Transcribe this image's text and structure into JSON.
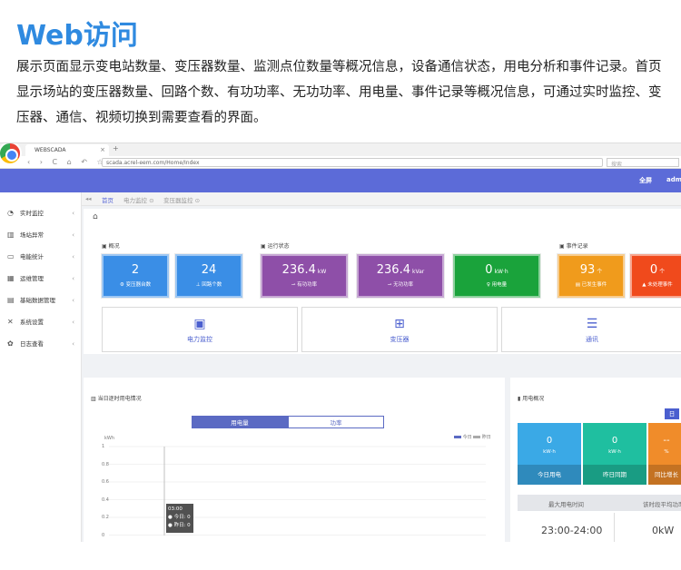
{
  "doc": {
    "title": "Web访问",
    "paragraph": "展示页面显示变电站数量、变压器数量、监测点位数量等概况信息，设备通信状态，用电分析和事件记录。首页显示场站的变压器数量、回路个数、有功功率、无功功率、用电量、事件记录等概况信息，可通过实时监控、变压器、通信、视频切换到需要查看的界面。"
  },
  "browser": {
    "tab_title": "WEBSCADA",
    "tab_close": "×",
    "new_tab": "+",
    "nav": "‹ › C ⌂ ↶ ☆",
    "url": "scada.acrel-eem.com/Home/Index",
    "search_hint": "搜索"
  },
  "header": {
    "fullscreen": "全屏",
    "user": "admin"
  },
  "sidebar": {
    "items": [
      {
        "icon": "gauge-icon",
        "glyph": "◔",
        "label": "实时监控"
      },
      {
        "icon": "building-icon",
        "glyph": "▥",
        "label": "场站异常"
      },
      {
        "icon": "monitor-icon",
        "glyph": "▭",
        "label": "电能统计"
      },
      {
        "icon": "grid-icon",
        "glyph": "▦",
        "label": "运维管理"
      },
      {
        "icon": "calendar-icon",
        "glyph": "▤",
        "label": "基础数据管理"
      },
      {
        "icon": "tools-icon",
        "glyph": "✕",
        "label": "系统设置"
      },
      {
        "icon": "gear-icon",
        "glyph": "✿",
        "label": "日志查看"
      }
    ]
  },
  "tabs": {
    "collapse": "◂◂",
    "items": [
      "首页",
      "电力监控 ⊙",
      "变压器监控 ⊙"
    ]
  },
  "overview": {
    "title": "概况",
    "cards": [
      {
        "value": "2",
        "unit": "",
        "label": "变压器台数",
        "color": "#3a8ee6"
      },
      {
        "value": "24",
        "unit": "",
        "label": "回路个数",
        "color": "#3a8ee6"
      }
    ]
  },
  "status": {
    "title": "运行状态",
    "cards": [
      {
        "value": "236.4",
        "unit": "kW",
        "label": "有功功率",
        "color": "#8e4fa8"
      },
      {
        "value": "236.4",
        "unit": "kVar",
        "label": "无功功率",
        "color": "#8e4fa8"
      },
      {
        "value": "0",
        "unit": "kW·h",
        "label": "用电量",
        "color": "#1aa33b"
      }
    ]
  },
  "events": {
    "title": "事件记录",
    "cards": [
      {
        "value": "93",
        "unit": "个",
        "label": "已发生事件",
        "color": "#f09b1c"
      },
      {
        "value": "0",
        "unit": "个",
        "label": "未处理事件",
        "color": "#f04a1c"
      }
    ]
  },
  "tiles": [
    {
      "icon": "power-monitor-icon",
      "label": "电力监控"
    },
    {
      "icon": "transformer-icon",
      "label": "变压器"
    },
    {
      "icon": "communication-icon",
      "label": "通讯"
    }
  ],
  "chart": {
    "title": "当日逐时用电情况",
    "toggle": [
      "用电量",
      "功率"
    ],
    "unit": "kWh",
    "legend": [
      "今日",
      "昨日"
    ],
    "yticks": [
      "1",
      "0.8",
      "0.6",
      "0.4",
      "0.2",
      "0"
    ],
    "tooltip": {
      "time": "03:00",
      "today": "今日: 0",
      "yesterday": "昨日: 0"
    }
  },
  "usage": {
    "title": "用电概况",
    "day_btn": "日",
    "cards": [
      {
        "value": "0",
        "unit": "kW·h",
        "label": "今日用电",
        "color": "#3aa9e6"
      },
      {
        "value": "0",
        "unit": "kW·h",
        "label": "昨日同期",
        "color": "#1fbfa0"
      },
      {
        "value": "--",
        "unit": "%",
        "label": "同比增长",
        "color": "#f08c2a"
      }
    ],
    "max_period_label": "最大用电时间",
    "avg_label": "该时段平均功率",
    "max_period_value": "23:00-24:00",
    "avg_value": "0kW"
  }
}
